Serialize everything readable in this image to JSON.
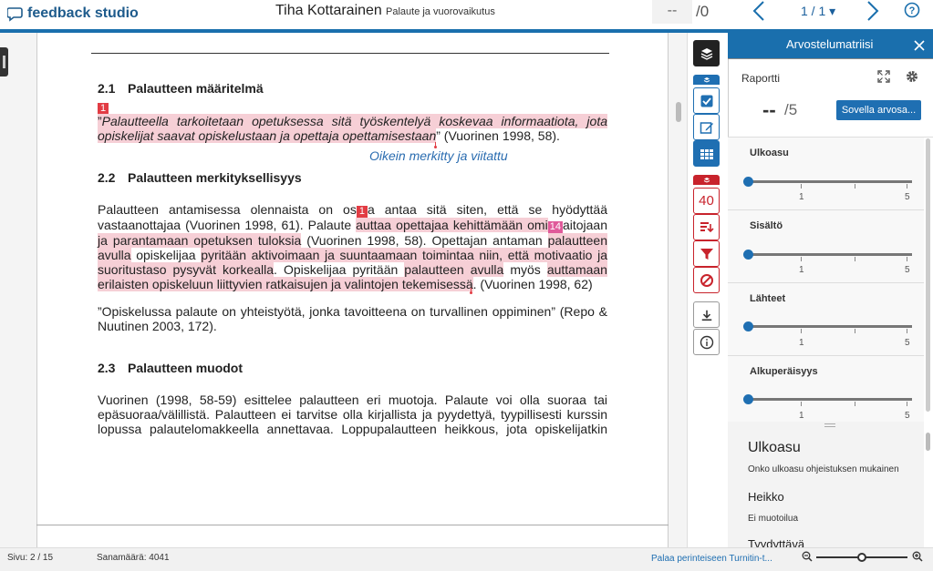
{
  "header": {
    "logo_text": "feedback studio",
    "student_name": "Tiha Kottarainen",
    "assignment": "Palaute ja vuorovaikutus",
    "score_value": "--",
    "score_total": "/0",
    "page_indicator": "1 / 1 ▾"
  },
  "document": {
    "section_1": {
      "number": "2.1",
      "title": "Palautteen määritelmä"
    },
    "marker_1": "1",
    "quote_line1": "Palautteella tarkoitetaan opetuksessa sitä työskentelyä koskevaa informaatiota, jota",
    "quote_line2_hl": "opiskelijat saavat opiskelustaan ja opettaja opettamisestaan",
    "quote_line2_rest": "” (Vuorinen 1998, 58).",
    "quote_open": "”",
    "comment": "Oikein merkitty ja viitattu",
    "section_2": {
      "number": "2.2",
      "title": "Palautteen merkityksellisyys"
    },
    "p2": {
      "l1a": "Palautteen antamisessa olennaista on os",
      "l1_marker": "1",
      "l1b": "a antaa sitä siten, että se hyödyttää",
      "l2a": "vastaanottajaa (Vuorinen 1998, 61). Palaute ",
      "l2_hl": "auttaa opettajaa kehittämään omi",
      "l2_marker": "14",
      "l2b": "aitojaan",
      "l3_hl": "ja parantamaan opetuksen tuloksia",
      "l3b": " (Vuorinen 1998, 58). Opettajan antaman ",
      "l3_hl2": "palautteen",
      "l4_hl": "avulla",
      "l4b": " opiskelijaa ",
      "l4_hl2": "pyritään aktivoimaan ja suuntaamaan toimintaa niin, että motivaatio ja",
      "l5_hl": "suoritustaso pysyvät korkealla",
      "l5b": ". Opiskelijaa pyritään ",
      "l5_hl2": "palautteen avulla",
      "l5c": " myös ",
      "l5_hl3": "auttamaan",
      "l6_hl": "erilaisten opiskeluun liittyvien ratkaisujen ja valintojen tekemisessä",
      "l6b": ". (Vuorinen 1998, 62)"
    },
    "p3": {
      "l1": "”Opiskelussa palaute on yhteistyötä, jonka tavoitteena on turvallinen oppiminen” (Repo &",
      "l2": "Nuutinen 2003, 172)."
    },
    "section_3": {
      "number": "2.3",
      "title": "Palautteen muodot"
    },
    "p4": {
      "l1": "Vuorinen (1998, 58-59) esittelee palautteen eri muotoja. Palaute voi olla suoraa tai",
      "l2": "epäsuoraa/välillistä. Palautteen ei tarvitse olla kirjallista ja pyydettyä, tyypillisesti kurssin",
      "l3": "lopussa palautelomakkeella annettavaa. Loppupalautteen heikkous, jota opiskelijatkin"
    }
  },
  "toolbar": {
    "grading_count": "40"
  },
  "panel": {
    "title": "Arvostelumatriisi",
    "report_label": "Raportti",
    "score_value": "--",
    "score_total": "/5",
    "apply_button": "Sovella arvosa...",
    "criteria": [
      {
        "name": "Ulkoasu",
        "min": "1",
        "max": "5",
        "value": 0
      },
      {
        "name": "Sisältö",
        "min": "1",
        "max": "5",
        "value": 0
      },
      {
        "name": "Lähteet",
        "min": "1",
        "max": "5",
        "value": 0
      },
      {
        "name": "Alkuperäisyys",
        "min": "1",
        "max": "5",
        "value": 0
      }
    ],
    "detail": {
      "title": "Ulkoasu",
      "description": "Onko ulkoasu ohjeistuksen mukainen",
      "levels": [
        {
          "name": "Heikko",
          "desc": "Ei muotoilua"
        },
        {
          "name": "Tyydyttävä",
          "desc": ""
        }
      ]
    }
  },
  "footer": {
    "page": "Sivu: 2 / 15",
    "word_count": "Sanamäärä: 4041",
    "classic_link": "Palaa perinteiseen Turnitin-t..."
  },
  "colors": {
    "brand_blue": "#1a6fad",
    "highlight_pink": "#f6cfd6",
    "marker_red": "#e23c44"
  }
}
